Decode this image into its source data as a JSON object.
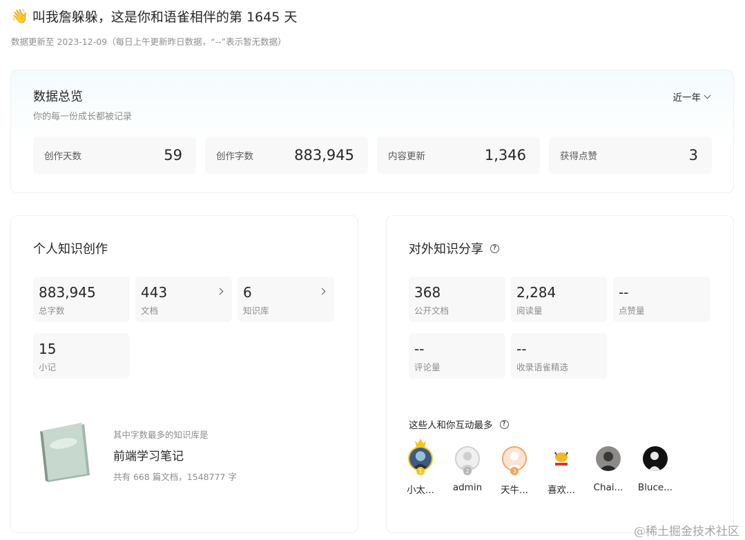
{
  "header": {
    "greeting_emoji": "👋",
    "greeting": "叫我詹躲躲，这是你和语雀相伴的第 1645 天",
    "update_note": "数据更新至 2023-12-09（每日上午更新昨日数据，“--”表示暂无数据）"
  },
  "overview": {
    "title": "数据总览",
    "subtitle": "你的每一份成长都被记录",
    "range_label": "近一年",
    "stats": [
      {
        "label": "创作天数",
        "value": "59"
      },
      {
        "label": "创作字数",
        "value": "883,945"
      },
      {
        "label": "内容更新",
        "value": "1,346"
      },
      {
        "label": "获得点赞",
        "value": "3"
      }
    ]
  },
  "personal": {
    "title": "个人知识创作",
    "tiles": [
      {
        "value": "883,945",
        "label": "总字数"
      },
      {
        "value": "443",
        "label": "文档"
      },
      {
        "value": "6",
        "label": "知识库"
      },
      {
        "value": "15",
        "label": "小记"
      }
    ],
    "top_kb": {
      "hint": "其中字数最多的知识库是",
      "name": "前端学习笔记",
      "count": "共有 668 篇文档，1548777 字"
    }
  },
  "sharing": {
    "title": "对外知识分享",
    "tiles": [
      {
        "value": "368",
        "label": "公开文档"
      },
      {
        "value": "2,284",
        "label": "阅读量"
      },
      {
        "value": "--",
        "label": "点赞量"
      },
      {
        "value": "--",
        "label": "评论量"
      },
      {
        "value": "--",
        "label": "收录语雀精选"
      }
    ],
    "interact_title": "这些人和你互动最多",
    "users": [
      {
        "name": "小太...",
        "rank": "1"
      },
      {
        "name": "admin",
        "rank": "2"
      },
      {
        "name": "天牛...",
        "rank": "3"
      },
      {
        "name": "喜欢..."
      },
      {
        "name": "Chai..."
      },
      {
        "name": "Bluce..."
      }
    ]
  },
  "colors": {
    "gold": "#f5c518",
    "silver": "#b5b5b5",
    "bronze": "#f0a35e"
  },
  "watermark": "@稀土掘金技术社区"
}
